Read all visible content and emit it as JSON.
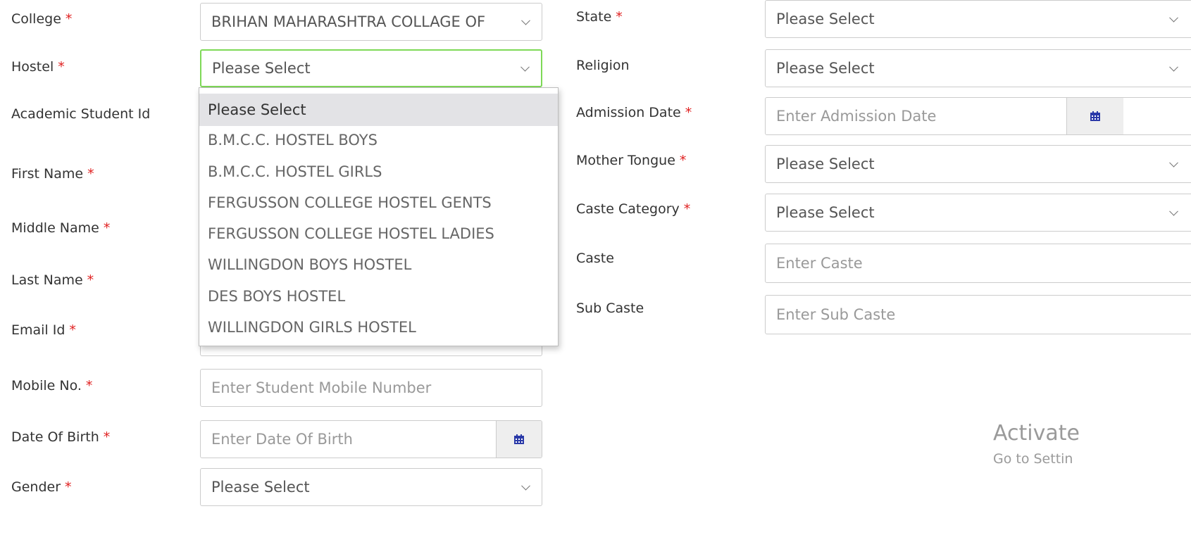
{
  "form": {
    "left": [
      {
        "label": "College",
        "required": true,
        "value": "BRIHAN MAHARASHTRA COLLAGE OF",
        "placeholder": "",
        "type": "select"
      },
      {
        "label": "Hostel",
        "required": true,
        "value": "Please Select",
        "placeholder": "",
        "type": "select"
      },
      {
        "label": "Academic Student Id",
        "required": false
      },
      {
        "label": "First Name",
        "required": true
      },
      {
        "label": "Middle Name",
        "required": true
      },
      {
        "label": "Last Name",
        "required": true
      },
      {
        "label": "Email Id",
        "required": true
      },
      {
        "label": "Mobile No.",
        "required": true,
        "value": "",
        "placeholder": "Enter Student Mobile Number",
        "type": "text"
      },
      {
        "label": "Date Of Birth",
        "required": true,
        "value": "",
        "placeholder": "Enter Date Of Birth",
        "type": "date"
      },
      {
        "label": "Gender",
        "required": true,
        "value": "Please Select",
        "placeholder": "",
        "type": "select"
      }
    ],
    "right": [
      {
        "label": "State",
        "required": true,
        "value": "Please Select",
        "placeholder": "",
        "type": "select"
      },
      {
        "label": "Religion",
        "required": false,
        "value": "Please Select",
        "placeholder": "",
        "type": "select"
      },
      {
        "label": "Admission Date",
        "required": true,
        "value": "",
        "placeholder": "Enter Admission Date",
        "type": "date"
      },
      {
        "label": "Mother Tongue",
        "required": true,
        "value": "Please Select",
        "placeholder": "",
        "type": "select"
      },
      {
        "label": "Caste Category",
        "required": true,
        "value": "Please Select",
        "placeholder": "",
        "type": "select"
      },
      {
        "label": "Caste",
        "required": false,
        "value": "",
        "placeholder": "Enter Caste",
        "type": "text"
      },
      {
        "label": "Sub Caste",
        "required": false,
        "value": "",
        "placeholder": "Enter Sub Caste",
        "type": "text"
      }
    ]
  },
  "hostel_dropdown": {
    "options": [
      "Please Select",
      "B.M.C.C. HOSTEL BOYS",
      "B.M.C.C. HOSTEL GIRLS",
      "FERGUSSON COLLEGE HOSTEL GENTS",
      "FERGUSSON COLLEGE HOSTEL LADIES",
      "WILLINGDON BOYS HOSTEL",
      "DES BOYS HOSTEL",
      "WILLINGDON GIRLS HOSTEL"
    ],
    "highlighted_index": 0
  },
  "required_marker": "*",
  "watermark": {
    "line1": "Activate",
    "line2": "Go to Settin"
  },
  "colors": {
    "required": "#e02020",
    "focus_border": "#7ed957",
    "highlight_bg": "#e3e3e6",
    "calendar_icon": "#2b3aa8"
  },
  "icons": {
    "select": "chevron-down-icon",
    "date": "calendar-icon"
  }
}
